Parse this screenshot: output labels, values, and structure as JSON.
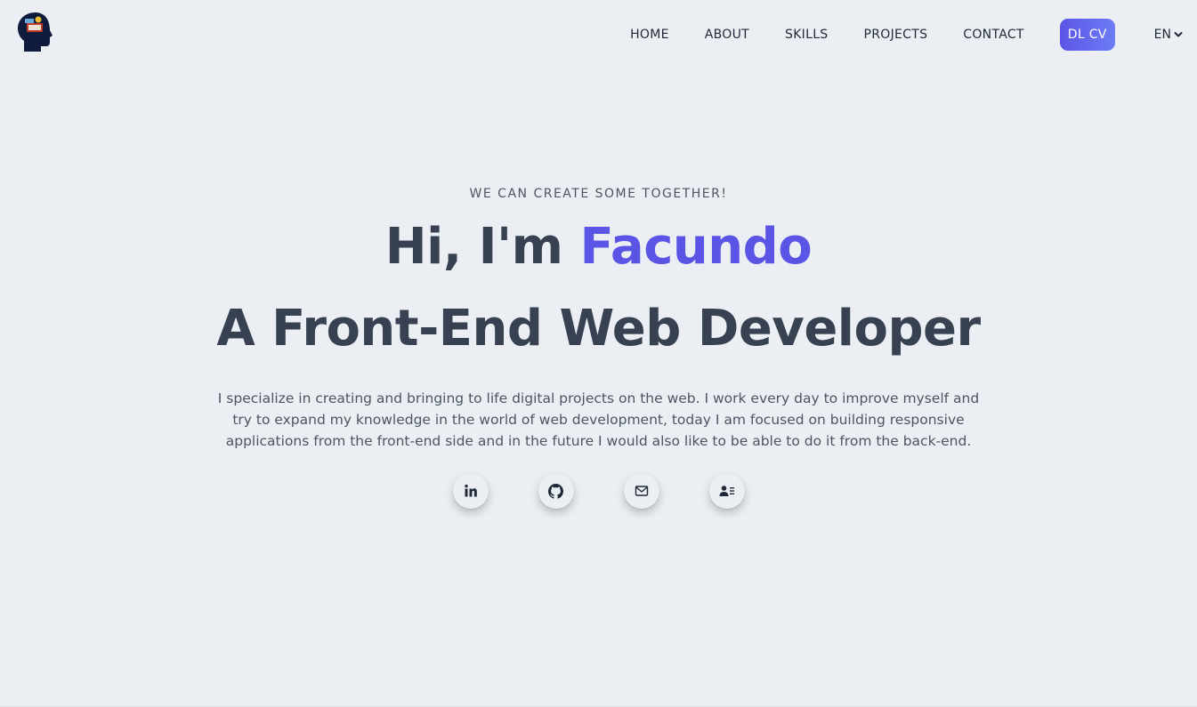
{
  "nav": {
    "items": [
      "HOME",
      "ABOUT",
      "SKILLS",
      "PROJECTS",
      "CONTACT"
    ],
    "cv_label": "DL CV",
    "lang_label": "EN"
  },
  "hero": {
    "eyebrow": "WE CAN CREATE SOME TOGETHER!",
    "greeting": "Hi, I'm",
    "name": "Facundo",
    "role": "A Front-End Web Developer",
    "description": "I specialize in creating and bringing to life digital projects on the web. I work every day to improve myself and try to expand my knowledge in the world of web development, today I am focused on building responsive applications from the front-end side and in the future I would also like to be able to do it from the back-end."
  },
  "socials": [
    {
      "icon": "linkedin-icon"
    },
    {
      "icon": "github-icon"
    },
    {
      "icon": "mail-icon"
    },
    {
      "icon": "contact-card-icon"
    }
  ],
  "colors": {
    "accent": "#5b55e6",
    "background": "#ebeff3",
    "heading": "#374151",
    "body": "#4b5563",
    "logo_dark": "#0f1b3a"
  }
}
